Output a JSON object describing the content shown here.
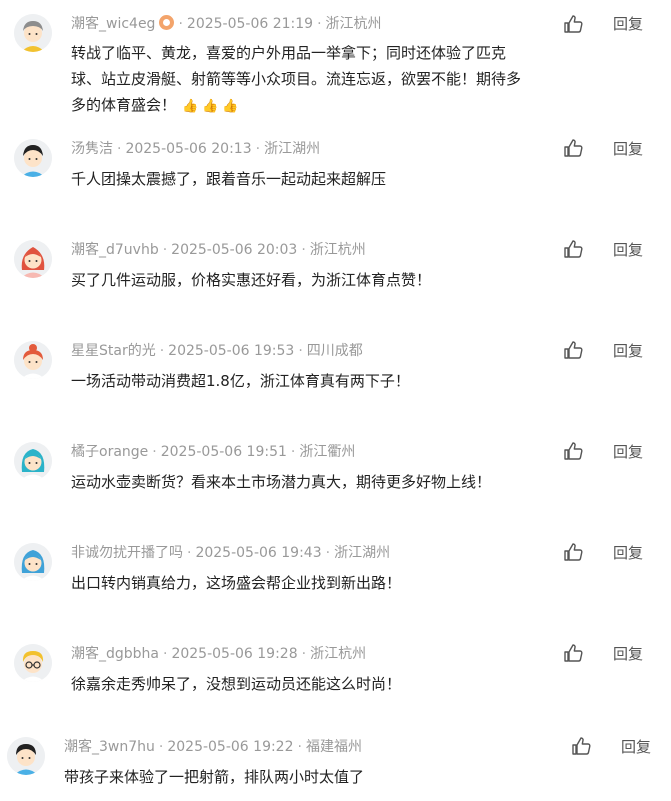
{
  "comments": [
    {
      "user": "潮客_wic4eg",
      "time": "2025-05-06 21:19",
      "location": "浙江杭州",
      "text": "转战了临平、黄龙，喜爱的户外用品一举拿下；同时还体验了匹克球、站立皮滑艇、射箭等等小众项目。流连忘返，欲罢不能！期待多多的体育盛会！",
      "emoji": "👍👍👍",
      "reply": "回复",
      "avatar": "grey-hair-avatar-icon"
    },
    {
      "user": "汤隽洁",
      "time": "2025-05-06 20:13",
      "location": "浙江湖州",
      "text": "千人团操太震撼了，跟着音乐一起动起来超解压",
      "reply": "回复",
      "avatar": "black-hair-avatar-icon"
    },
    {
      "user": "潮客_d7uvhb",
      "time": "2025-05-06 20:03",
      "location": "浙江杭州",
      "text": "买了几件运动服，价格实惠还好看，为浙江体育点赞！",
      "reply": "回复",
      "avatar": "red-hair-avatar-icon"
    },
    {
      "user": "星星Star的光",
      "time": "2025-05-06 19:53",
      "location": "四川成都",
      "text": "一场活动带动消费超1.8亿，浙江体育真有两下子！",
      "reply": "回复",
      "avatar": "red-bun-avatar-icon"
    },
    {
      "user": "橘子orange",
      "time": "2025-05-06 19:51",
      "location": "浙江衢州",
      "text": "运动水壶卖断货？看来本土市场潜力真大，期待更多好物上线！",
      "reply": "回复",
      "avatar": "teal-hair-avatar-icon"
    },
    {
      "user": "非诚勿扰开播了吗",
      "time": "2025-05-06 19:43",
      "location": "浙江湖州",
      "text": "出口转内销真给力，这场盛会帮企业找到新出路！",
      "reply": "回复",
      "avatar": "blue-hair-avatar-icon"
    },
    {
      "user": "潮客_dgbbha",
      "time": "2025-05-06 19:28",
      "location": "浙江杭州",
      "text": "徐嘉余走秀帅呆了，没想到运动员还能这么时尚！",
      "reply": "回复",
      "avatar": "glasses-avatar-icon"
    },
    {
      "user": "潮客_3wn7hu",
      "time": "2025-05-06 19:22",
      "location": "福建福州",
      "text": "带孩子来体验了一把射箭，排队两小时太值了",
      "reply": "回复",
      "avatar": "short-hair-avatar-icon"
    }
  ]
}
